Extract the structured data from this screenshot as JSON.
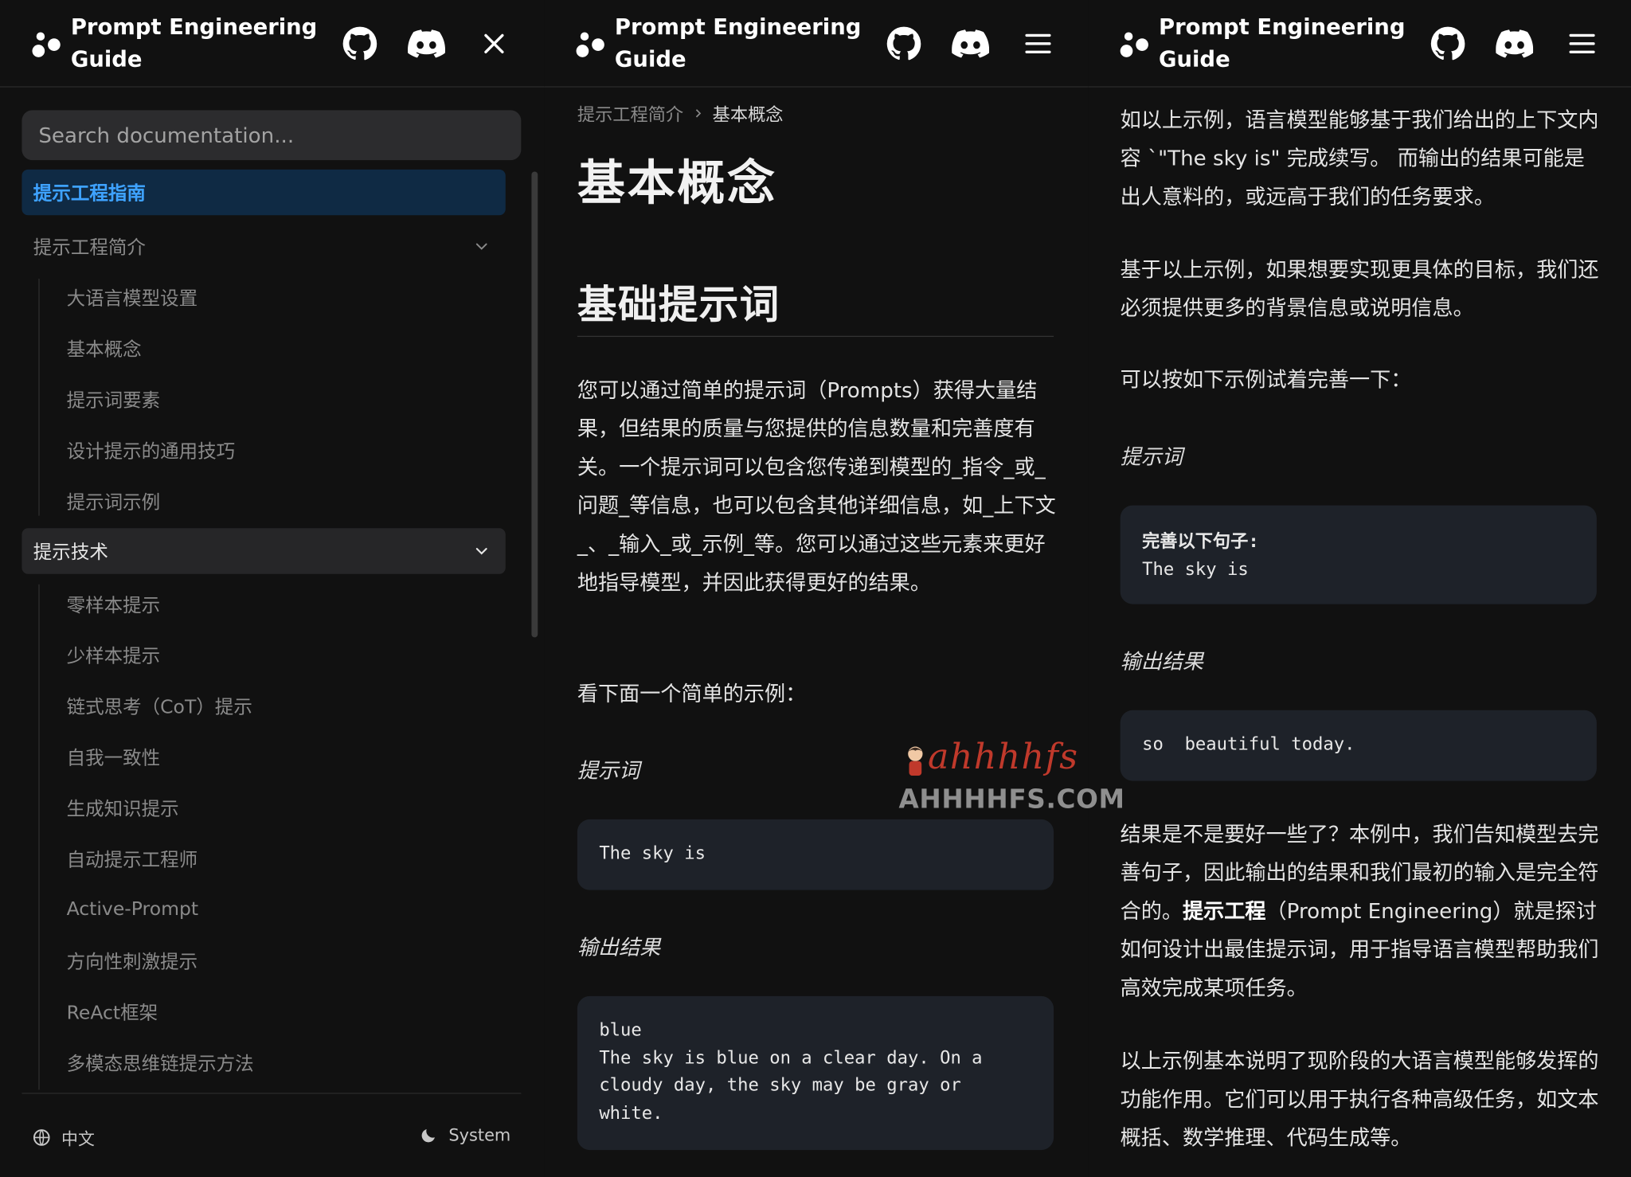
{
  "brand": {
    "name": "Prompt Engineering Guide"
  },
  "sidebar": {
    "search_placeholder": "Search documentation...",
    "items": [
      {
        "label": "提示工程指南",
        "state": "active"
      },
      {
        "label": "提示工程简介",
        "state": "collapsible"
      },
      {
        "label": "大语言模型设置",
        "state": "sub"
      },
      {
        "label": "基本概念",
        "state": "sub"
      },
      {
        "label": "提示词要素",
        "state": "sub"
      },
      {
        "label": "设计提示的通用技巧",
        "state": "sub"
      },
      {
        "label": "提示词示例",
        "state": "sub"
      },
      {
        "label": "提示技术",
        "state": "open"
      },
      {
        "label": "零样本提示",
        "state": "sub"
      },
      {
        "label": "少样本提示",
        "state": "sub"
      },
      {
        "label": "链式思考（CoT）提示",
        "state": "sub"
      },
      {
        "label": "自我一致性",
        "state": "sub"
      },
      {
        "label": "生成知识提示",
        "state": "sub"
      },
      {
        "label": "自动提示工程师",
        "state": "sub"
      },
      {
        "label": "Active-Prompt",
        "state": "sub"
      },
      {
        "label": "方向性刺激提示",
        "state": "sub"
      },
      {
        "label": "ReAct框架",
        "state": "sub"
      },
      {
        "label": "多模态思维链提示方法",
        "state": "sub"
      }
    ],
    "language": "中文",
    "theme": "System"
  },
  "article": {
    "breadcrumb": [
      "提示工程简介",
      "基本概念"
    ],
    "title": "基本概念",
    "section_title": "基础提示词",
    "intro": "您可以通过简单的提示词（Prompts）获得大量结果，但结果的质量与您提供的信息数量和完善度有关。一个提示词可以包含您传递到模型的_指令_或_问题_等信息，也可以包含其他详细信息，如_上下文_、_输入_或_示例_等。您可以通过这些元素来更好地指导模型，并因此获得更好的结果。",
    "example_lead": "看下面一个简单的示例：",
    "prompt_label": "提示词",
    "prompt_code": "The sky is",
    "output_label": "输出结果",
    "output_code": "blue\nThe sky is blue on a clear day. On a cloudy day, the sky may be gray or white.",
    "p3_para1": "如以上示例，语言模型能够基于我们给出的上下文内容 `\"The sky is\" 完成续写。 而输出的结果可能是出人意料的，或远高于我们的任务要求。",
    "p3_para2": "基于以上示例，如果想要实现更具体的目标，我们还必须提供更多的背景信息或说明信息。",
    "p3_para3": "可以按如下示例试着完善一下：",
    "p3_prompt_label": "提示词",
    "p3_prompt_code_bold": "完善以下句子:",
    "p3_prompt_code_rest": "The sky is",
    "p3_output_label": "输出结果",
    "p3_output_code": "so  beautiful today.",
    "p3_para4_a": "结果是不是要好一些了？本例中，我们告知模型去完善句子，因此输出的结果和我们最初的输入是完全符合的。",
    "p3_para4_strong": "提示工程",
    "p3_para4_b": "（Prompt Engineering）就是探讨如何设计出最佳提示词，用于指导语言模型帮助我们高效完成某项任务。",
    "p3_para5": "以上示例基本说明了现阶段的大语言模型能够发挥的功能作用。它们可以用于执行各种高级任务，如文本概括、数学推理、代码生成等。"
  },
  "watermark": {
    "script": "ahhhhfs",
    "text": "AHHHHFS.COM"
  },
  "colors": {
    "background": "#111111",
    "accent": "#3ea2ff",
    "code_bg": "#1e2229",
    "watermark_red": "#c0392b"
  },
  "icons": [
    "github-icon",
    "discord-icon",
    "close-icon",
    "menu-icon",
    "chevron-down-icon",
    "globe-icon",
    "moon-icon"
  ]
}
